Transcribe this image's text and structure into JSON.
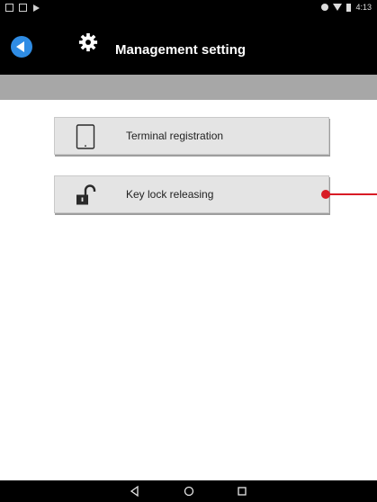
{
  "status_bar": {
    "time": "4:13"
  },
  "header": {
    "title": "Management setting",
    "back_icon": "back-arrow-icon",
    "settings_icon": "gear-icon"
  },
  "menu": {
    "items": [
      {
        "label": "Terminal registration",
        "icon": "tablet-icon"
      },
      {
        "label": "Key lock releasing",
        "icon": "unlock-icon"
      }
    ]
  },
  "colors": {
    "accent": "#2f8ce4",
    "callout": "#d81b25",
    "strip": "#a7a7a7"
  }
}
